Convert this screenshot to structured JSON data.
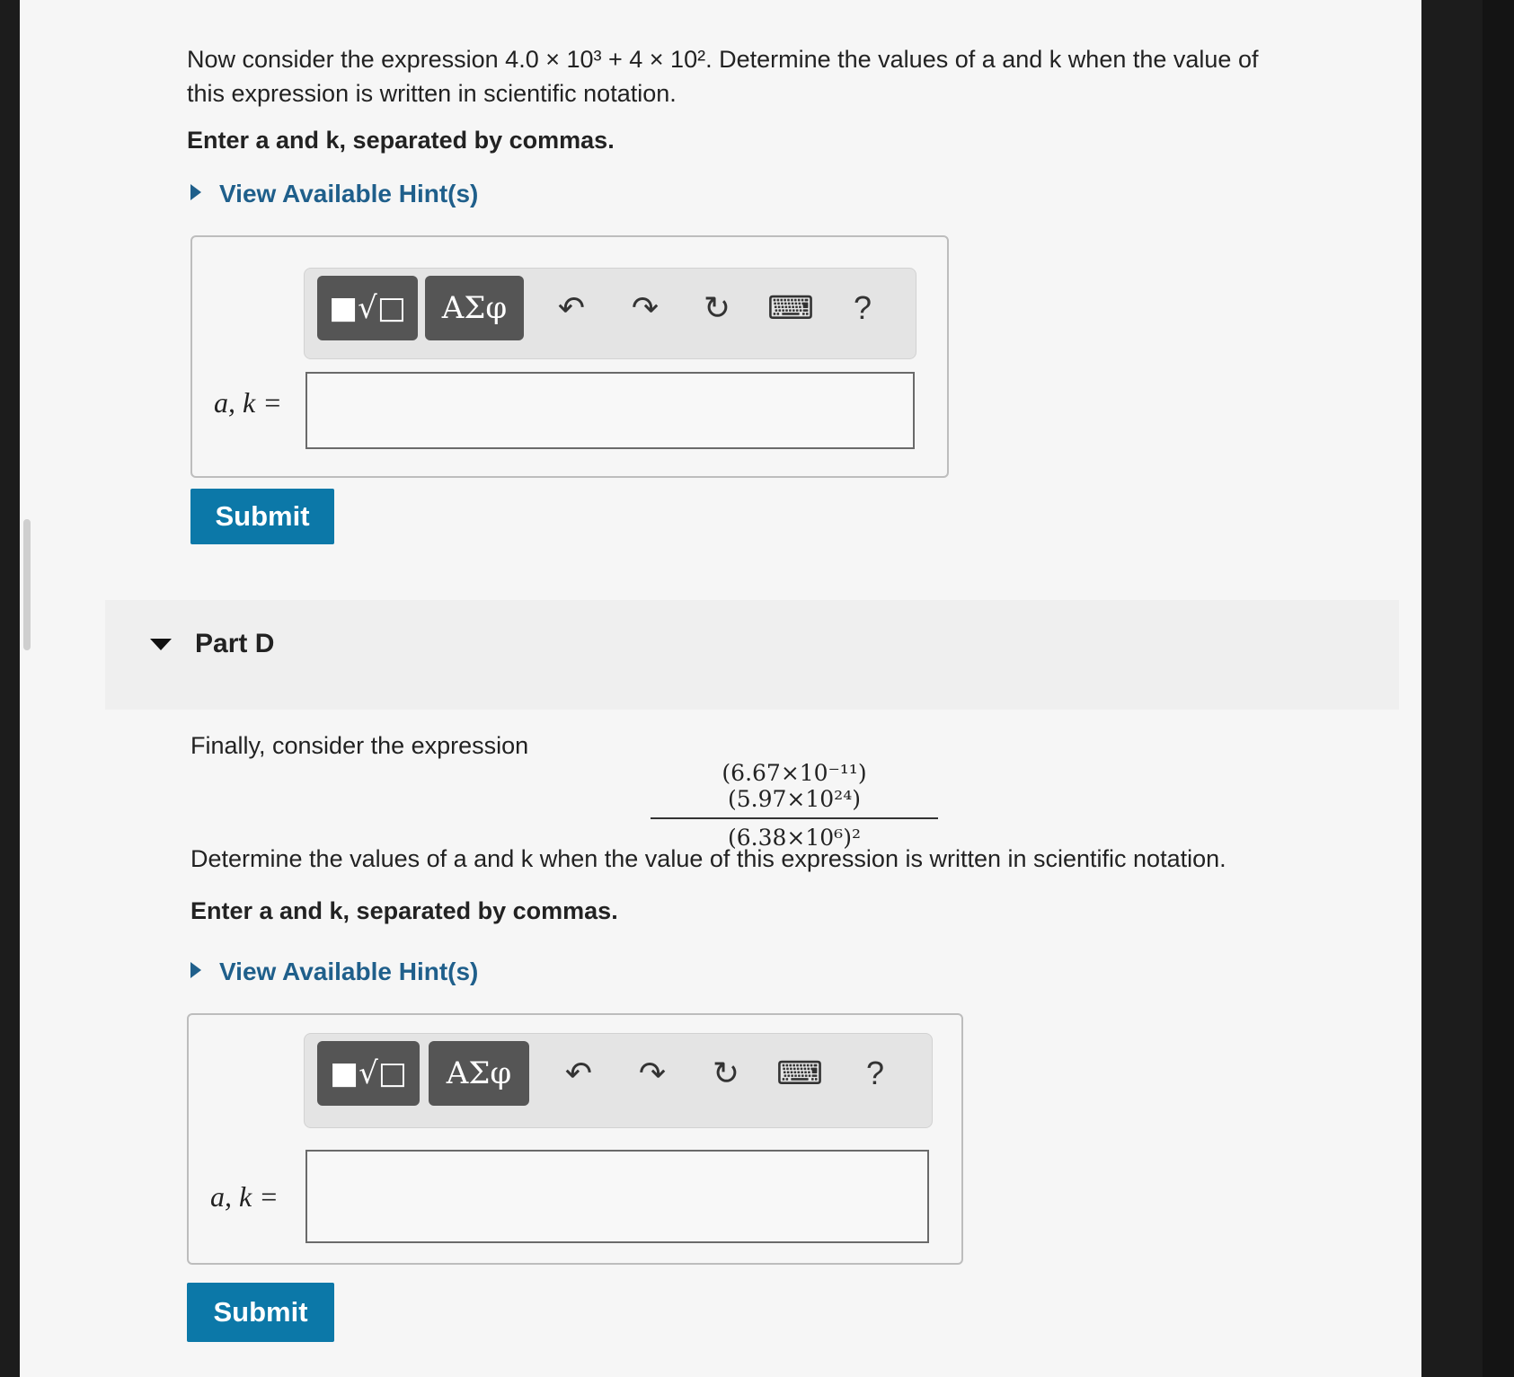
{
  "partC": {
    "question_line1": "Now consider the expression 4.0 × 10³ + 4 × 10². Determine the values of a and k when the value of",
    "question_line2": "this expression is written in scientific notation.",
    "instruction": "Enter a and k, separated by commas.",
    "hint_link": "View Available Hint(s)",
    "answer_label": "a, k =",
    "answer_value": "",
    "submit_label": "Submit"
  },
  "partD": {
    "title": "Part D",
    "intro": "Finally, consider the expression",
    "numerator": "(6.67×10⁻¹¹)(5.97×10²⁴)",
    "denominator": "(6.38×10⁶)²",
    "question": "Determine the values of a and k when the value of this expression is written in scientific notation.",
    "instruction": "Enter a and k, separated by commas.",
    "hint_link": "View Available Hint(s)",
    "answer_label": "a, k =",
    "answer_value": "",
    "submit_label": "Submit"
  },
  "toolbar": {
    "templates_glyph": "■√□",
    "greek_label": "ΑΣφ",
    "undo_glyph": "↶",
    "redo_glyph": "↷",
    "reset_glyph": "↻",
    "keyboard_glyph": "⌨",
    "help_label": "?"
  },
  "colors": {
    "submit_bg": "#0c78a8",
    "hint_link": "#1f5f8b",
    "toolbar_button": "#555555"
  }
}
